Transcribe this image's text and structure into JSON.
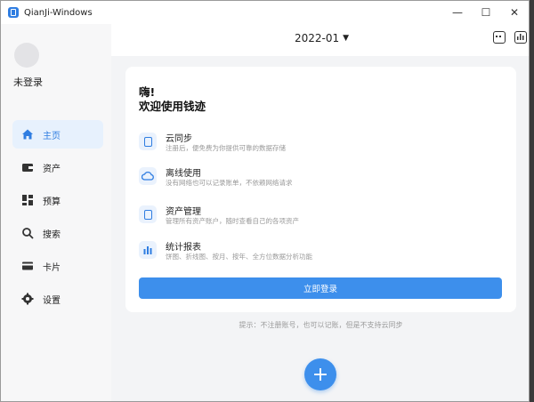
{
  "window": {
    "title": "QianJi-Windows",
    "controls": {
      "minimize": "—",
      "maximize": "☐",
      "close": "✕"
    }
  },
  "sidebar": {
    "user_label": "未登录",
    "items": [
      {
        "label": "主页",
        "icon": "home-icon",
        "active": true
      },
      {
        "label": "资产",
        "icon": "wallet-icon",
        "active": false
      },
      {
        "label": "预算",
        "icon": "grid-icon",
        "active": false
      },
      {
        "label": "搜索",
        "icon": "search-icon",
        "active": false
      },
      {
        "label": "卡片",
        "icon": "card-icon",
        "active": false
      },
      {
        "label": "设置",
        "icon": "gear-icon",
        "active": false
      }
    ]
  },
  "header": {
    "month": "2022-01",
    "icons": [
      "calendar-icon",
      "chart-icon"
    ]
  },
  "welcome_card": {
    "greeting": "嗨!",
    "title": "欢迎使用钱迹",
    "features": [
      {
        "title": "云同步",
        "desc": "注册后，便免费为你提供可靠的数据存储",
        "icon": "sync-icon"
      },
      {
        "title": "离线使用",
        "desc": "没有网络也可以记录账单，不依赖网络请求",
        "icon": "cloud-offline-icon"
      },
      {
        "title": "资产管理",
        "desc": "管理所有资产账户，随时查看自己的各项资产",
        "icon": "asset-icon"
      },
      {
        "title": "统计报表",
        "desc": "饼图、折线图、按月、按年、全方位数据分析功能",
        "icon": "report-icon"
      }
    ],
    "login_button": "立即登录"
  },
  "hint": "提示：不注册账号，也可以记账，但是不支持云同步",
  "fab_label": "+",
  "colors": {
    "accent": "#3d8fec",
    "active_bg": "#e7f1fd",
    "background": "#f3f4f6"
  }
}
